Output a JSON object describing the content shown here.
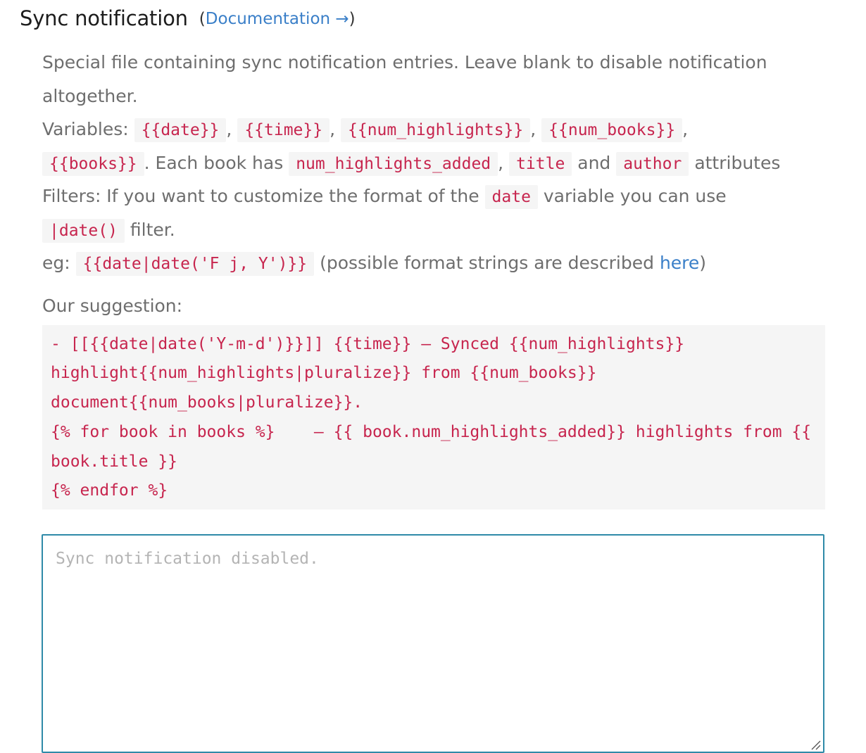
{
  "header": {
    "title": "Sync notification",
    "doc_open_paren": "(",
    "doc_link": "Documentation →",
    "doc_close_paren": ")"
  },
  "description": {
    "intro": "Special file containing sync notification entries. Leave blank to disable notification altogether.",
    "variables_label": "Variables:",
    "vars": {
      "date": "{{date}}",
      "time": "{{time}}",
      "num_highlights": "{{num_highlights}}",
      "num_books": "{{num_books}}",
      "books": "{{books}}"
    },
    "each_book_has": ". Each book has",
    "attrs": {
      "num_highlights_added": "num_highlights_added",
      "title": "title",
      "author": "author"
    },
    "and": "and",
    "attributes": "attributes",
    "filters_text": "Filters: If you want to customize the format of the",
    "date_code": "date",
    "filters_text_2": "variable you can use",
    "date_filter": "|date()",
    "filter_word": "filter.",
    "eg_label": "eg:",
    "eg_code": "{{date|date('F j, Y')}}",
    "eg_paren_open": "(possible format strings are described",
    "here_link": "here",
    "eg_paren_close": ")"
  },
  "suggestion": {
    "label": "Our suggestion:",
    "code": "- [[{{date|date('Y-m-d')}}]] {{time}} — Synced {{num_highlights}} highlight{{num_highlights|pluralize}} from {{num_books}} document{{num_books|pluralize}}.\n{% for book in books %}    — {{ book.num_highlights_added}} highlights from {{ book.title }}\n{% endfor %}"
  },
  "textarea": {
    "value": "",
    "placeholder": "Sync notification disabled."
  },
  "colors": {
    "code_text": "#c7254e",
    "code_bg": "#f5f5f5",
    "link": "#3a7fc8",
    "textarea_border": "#2e8aa8",
    "muted_text": "#6e6e6e"
  }
}
